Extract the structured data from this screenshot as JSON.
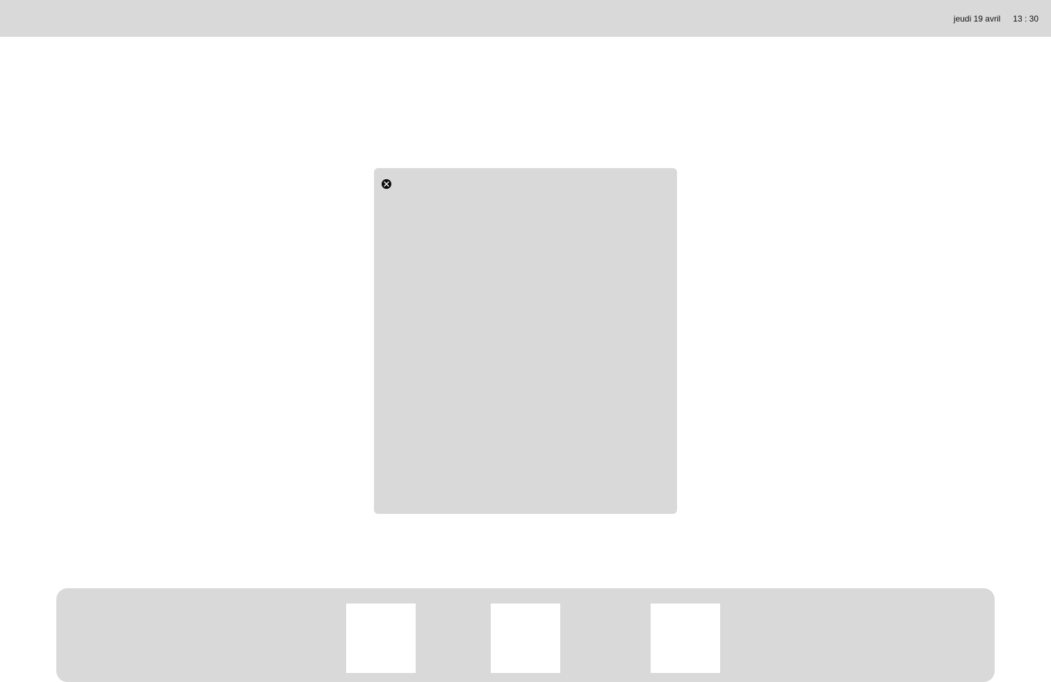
{
  "menubar": {
    "date": "jeudi 19 avril",
    "time": "13 : 30"
  },
  "window": {
    "close_icon": "close-icon"
  },
  "dock": {
    "item_count": 3
  },
  "colors": {
    "chrome_gray": "#d9d9d9",
    "background": "#ffffff",
    "close_button": "#0d0d0d"
  }
}
